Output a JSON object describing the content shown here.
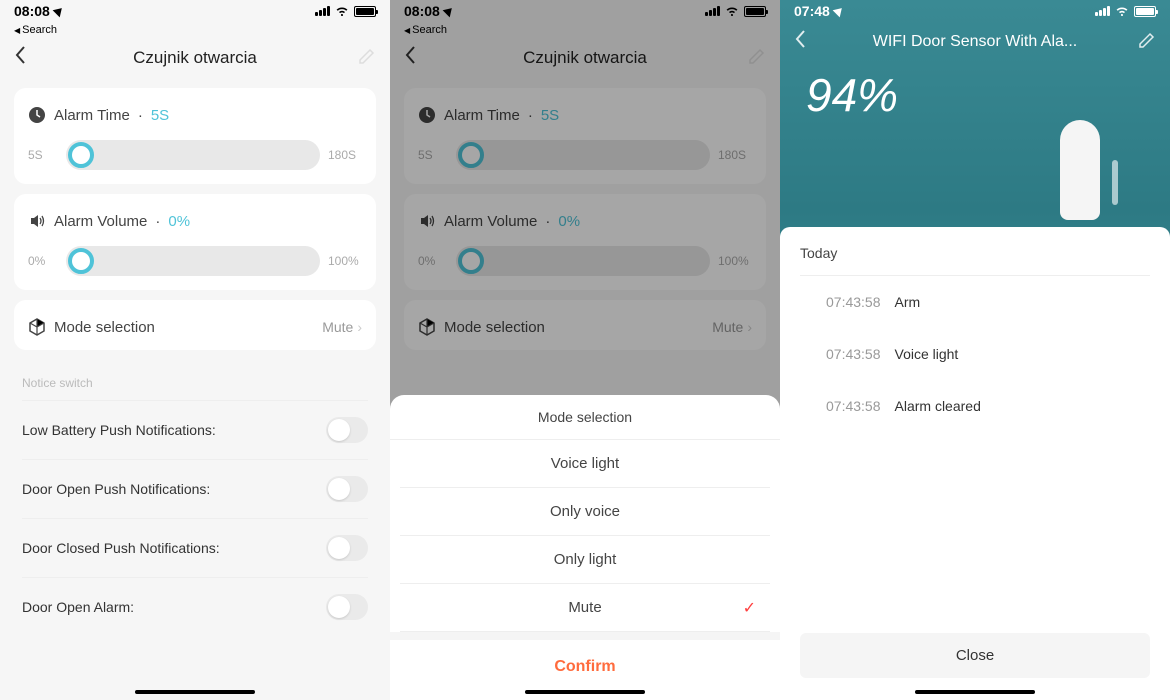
{
  "screen1": {
    "status": {
      "time": "08:08",
      "back_search": "Search"
    },
    "header": {
      "title": "Czujnik otwarcia"
    },
    "alarm_time": {
      "label": "Alarm Time",
      "value": "5S",
      "min": "5S",
      "max": "180S"
    },
    "alarm_volume": {
      "label": "Alarm Volume",
      "value": "0%",
      "min": "0%",
      "max": "100%"
    },
    "mode": {
      "label": "Mode selection",
      "value": "Mute"
    },
    "notice": {
      "section": "Notice switch",
      "items": [
        {
          "label": "Low Battery Push Notifications:"
        },
        {
          "label": "Door Open Push Notifications:"
        },
        {
          "label": "Door Closed Push Notifications:"
        },
        {
          "label": "Door Open Alarm:"
        }
      ]
    }
  },
  "screen2": {
    "status": {
      "time": "08:08",
      "back_search": "Search"
    },
    "header": {
      "title": "Czujnik otwarcia"
    },
    "alarm_time": {
      "label": "Alarm Time",
      "value": "5S",
      "min": "5S",
      "max": "180S"
    },
    "alarm_volume": {
      "label": "Alarm Volume",
      "value": "0%",
      "min": "0%",
      "max": "100%"
    },
    "mode": {
      "label": "Mode selection",
      "value": "Mute"
    },
    "sheet": {
      "title": "Mode selection",
      "options": [
        "Voice light",
        "Only voice",
        "Only light",
        "Mute"
      ],
      "selected_index": 3,
      "confirm": "Confirm"
    }
  },
  "screen3": {
    "status": {
      "time": "07:48"
    },
    "header": {
      "title": "WIFI Door Sensor With Ala..."
    },
    "battery_pct": "94%",
    "history": {
      "title": "Today",
      "rows": [
        {
          "time": "07:43:58",
          "event": "Arm"
        },
        {
          "time": "07:43:58",
          "event": "Voice light"
        },
        {
          "time": "07:43:58",
          "event": "Alarm cleared"
        }
      ],
      "close": "Close"
    }
  }
}
